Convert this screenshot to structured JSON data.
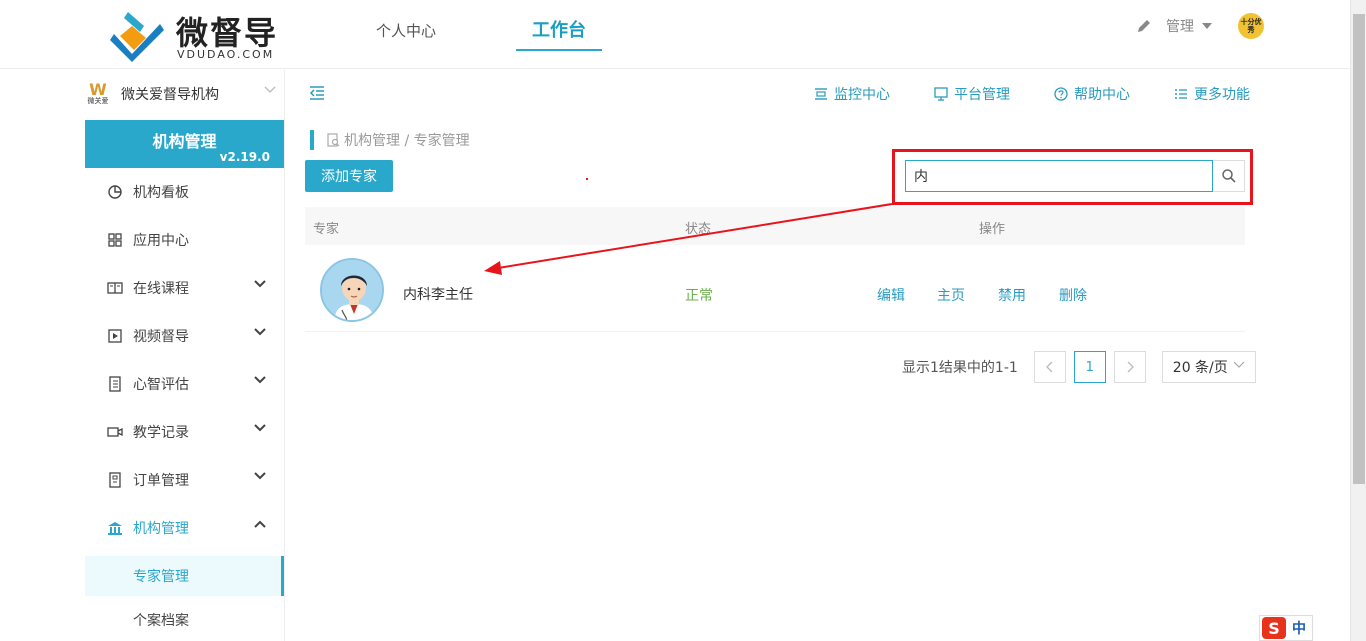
{
  "brand": {
    "name": "微督导",
    "subtitle": "VDUDAO.COM"
  },
  "top_nav": [
    {
      "label": "个人中心",
      "active": false
    },
    {
      "label": "工作台",
      "active": true
    }
  ],
  "user_menu": {
    "label": "管理",
    "avatar_text": "十分优秀"
  },
  "sidebar": {
    "org": {
      "logo_text": "微关爱",
      "name": "微关爱督导机构"
    },
    "module": {
      "title": "机构管理",
      "version": "v2.19.0"
    },
    "items": [
      {
        "label": "机构看板",
        "icon": "pie-chart-icon",
        "expandable": false
      },
      {
        "label": "应用中心",
        "icon": "grid-icon",
        "expandable": false
      },
      {
        "label": "在线课程",
        "icon": "book-icon",
        "expandable": true
      },
      {
        "label": "视频督导",
        "icon": "play-icon",
        "expandable": true
      },
      {
        "label": "心智评估",
        "icon": "clipboard-icon",
        "expandable": true
      },
      {
        "label": "教学记录",
        "icon": "video-camera-icon",
        "expandable": true
      },
      {
        "label": "订单管理",
        "icon": "receipt-icon",
        "expandable": true
      },
      {
        "label": "机构管理",
        "icon": "bank-icon",
        "expandable": true,
        "open": true
      }
    ],
    "submenu": [
      {
        "label": "专家管理",
        "active": true
      },
      {
        "label": "个案档案",
        "active": false
      }
    ]
  },
  "quick_links": [
    {
      "label": "监控中心",
      "icon": "monitor-list-icon"
    },
    {
      "label": "平台管理",
      "icon": "desktop-icon"
    },
    {
      "label": "帮助中心",
      "icon": "help-circle-icon"
    },
    {
      "label": "更多功能",
      "icon": "list-icon"
    }
  ],
  "breadcrumb": "机构管理 / 专家管理",
  "toolbar": {
    "add_label": "添加专家",
    "search_value": "内"
  },
  "table": {
    "columns": [
      "专家",
      "状态",
      "操作"
    ],
    "rows": [
      {
        "name": "内科李主任",
        "status": "正常",
        "actions": [
          "编辑",
          "主页",
          "禁用",
          "删除"
        ]
      }
    ]
  },
  "pagination": {
    "info": "显示1结果中的1-1",
    "current_page": "1",
    "page_size": "20 条/页"
  },
  "ime": {
    "logo": "S",
    "mode": "中"
  },
  "colors": {
    "accent": "#2aa8cb",
    "status_ok": "#6ab04c",
    "annotation": "#e8141c"
  }
}
